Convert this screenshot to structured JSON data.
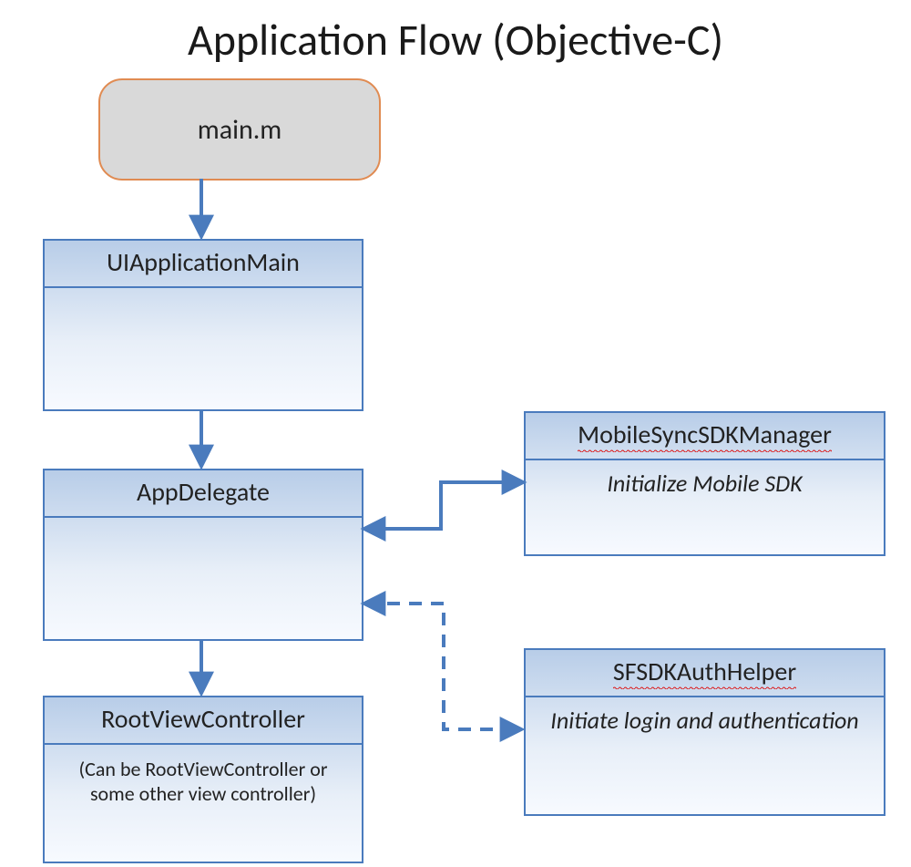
{
  "title": "Application Flow (Objective-C)",
  "nodes": {
    "main": {
      "label": "main.m"
    },
    "uiapp": {
      "header": "UIApplicationMain",
      "body": ""
    },
    "appdel": {
      "header": "AppDelegate",
      "body": ""
    },
    "root": {
      "header": "RootViewController",
      "body": "(Can be RootViewController or some other view controller)"
    },
    "mobilesync": {
      "header": "MobileSyncSDKManager",
      "body": "Initialize Mobile SDK"
    },
    "auth": {
      "header": "SFSDKAuthHelper",
      "body": "Initiate login and authentication"
    }
  },
  "arrows": [
    {
      "from": "main",
      "to": "uiapp",
      "style": "solid",
      "direction": "down"
    },
    {
      "from": "uiapp",
      "to": "appdel",
      "style": "solid",
      "direction": "down"
    },
    {
      "from": "appdel",
      "to": "root",
      "style": "solid",
      "direction": "down"
    },
    {
      "from": "mobilesync",
      "to": "appdel",
      "style": "solid",
      "direction": "both-elbow"
    },
    {
      "from": "appdel",
      "to": "auth",
      "style": "dashed",
      "direction": "both-elbow"
    }
  ],
  "colors": {
    "boxBorder": "#4a7bbd",
    "boxFillTop": "#b8cde8",
    "boxFillBottom": "#f7faff",
    "startFill": "#d9d9d9",
    "startBorder": "#e08b52",
    "arrow": "#4a7bbd"
  }
}
